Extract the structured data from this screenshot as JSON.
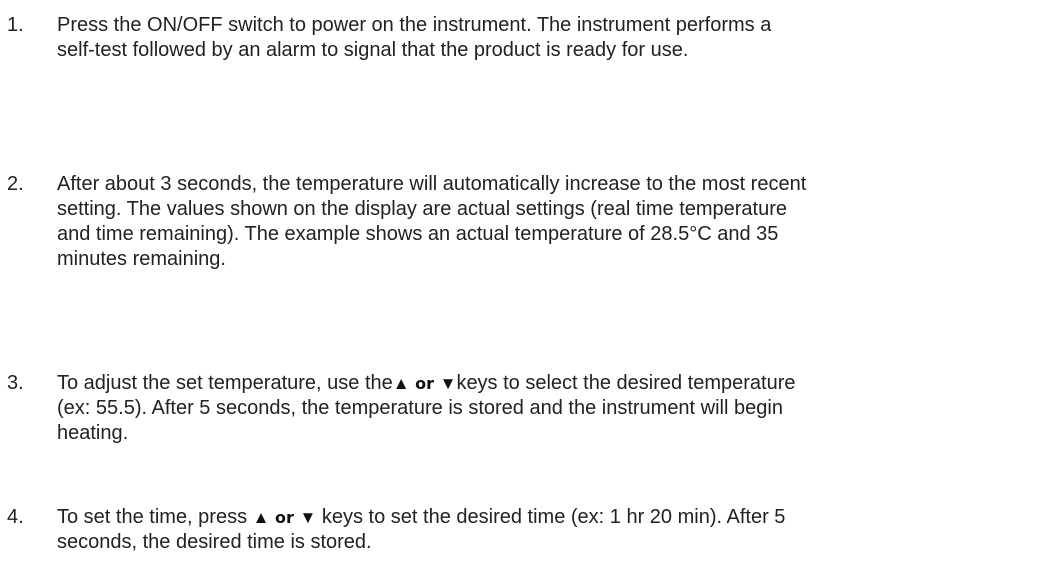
{
  "steps": [
    {
      "number": "1.",
      "lines": [
        "Press the ON/OFF switch to power on the instrument. The instrument performs a",
        "self-test followed by an alarm to signal that the product is ready for use."
      ]
    },
    {
      "number": "2.",
      "lines": [
        "After about 3 seconds, the temperature will automatically increase to the most recent",
        "setting. The values shown on the display are actual settings (real time temperature",
        "and time remaining). The example shows an actual temperature of 28.5°C and 35",
        "minutes remaining."
      ]
    },
    {
      "number": "3.",
      "line1_before": "To adjust the set temperature, use the",
      "line1_after": "keys to select the desired temperature",
      "lines_rest": [
        "(ex: 55.5). After 5 seconds, the temperature is stored and the instrument will begin",
        "heating."
      ]
    },
    {
      "number": "4.",
      "line1_before": "To set the time, press",
      "line1_after": "keys to set the desired time (ex: 1 hr 20 min). After 5",
      "lines_rest": [
        "seconds, the desired time is stored."
      ]
    }
  ],
  "keys": {
    "up_symbol": "▲",
    "down_symbol": "▼",
    "or_label": "or",
    "up_icon": "up-arrow-icon",
    "down_icon": "down-arrow-icon"
  }
}
